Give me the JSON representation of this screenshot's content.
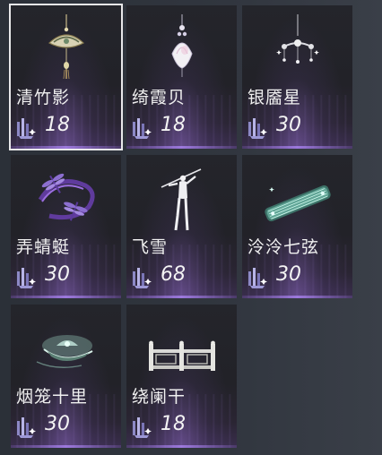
{
  "items": [
    {
      "name": "清竹影",
      "cost": "18",
      "icon": "jade-fan-pendant-icon",
      "selected": true
    },
    {
      "name": "绮霞贝",
      "cost": "18",
      "icon": "shell-pendant-icon",
      "selected": false
    },
    {
      "name": "银靥星",
      "cost": "30",
      "icon": "silver-star-chandelier-icon",
      "selected": false
    },
    {
      "name": "弄蜻蜓",
      "cost": "30",
      "icon": "dragonfly-ribbon-icon",
      "selected": false
    },
    {
      "name": "飞雪",
      "cost": "68",
      "icon": "sword-dancer-figure-icon",
      "selected": false
    },
    {
      "name": "泠泠七弦",
      "cost": "30",
      "icon": "guqin-zither-icon",
      "selected": false
    },
    {
      "name": "烟笼十里",
      "cost": "30",
      "icon": "misty-boat-icon",
      "selected": false
    },
    {
      "name": "绕阑干",
      "cost": "18",
      "icon": "stone-railing-icon",
      "selected": false
    }
  ],
  "currency_icon": "purple-crystal-currency-icon",
  "colors": {
    "background": "#2d323b",
    "card": "#222228",
    "glow": "#9a6fd6",
    "selected_border": "#e8e8ea",
    "text": "#f0f0f0"
  }
}
